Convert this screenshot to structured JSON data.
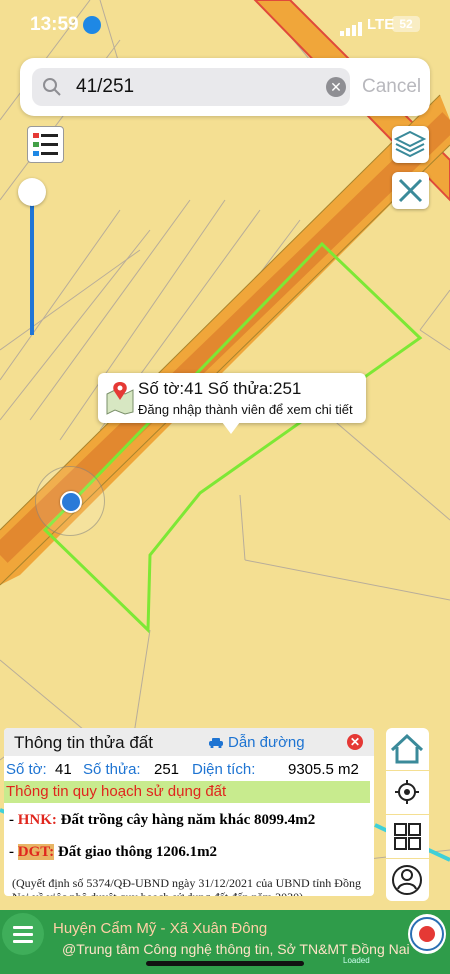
{
  "status_bar": {
    "time": "13:59",
    "network": "LTE",
    "battery": "52"
  },
  "search": {
    "value": "41/251",
    "placeholder": "",
    "cancel_label": "Cancel"
  },
  "popup": {
    "title": "Số tờ:41 Số thửa:251",
    "subtitle": "Đăng nhập thành viên để xem chi tiết"
  },
  "panel": {
    "title": "Thông tin thửa đất",
    "nav_label": "Dẫn đường",
    "sheet_label": "Số tờ:",
    "sheet_value": "41",
    "parcel_label": "Số thửa:",
    "parcel_value": "251",
    "area_label": "Diện tích:",
    "area_value": "9305.5 m2",
    "plan_header": "Thông tin quy hoạch sử dụng đất",
    "land_uses": [
      {
        "prefix": "- ",
        "code": "HNK:",
        "text": " Đất trồng cây hàng năm khác 8099.4m2"
      },
      {
        "prefix": "- ",
        "code": "DGT:",
        "text": " Đất giao thông 1206.1m2"
      }
    ],
    "decision": "(Quyết định số 5374/QĐ-UBND ngày 31/12/2021 của UBND tỉnh Đồng Nai về việc phê duyệt quy hoạch sử dụng đất đến năm 2030)"
  },
  "footer": {
    "district": "Huyện Cẩm Mỹ - Xã Xuân Đông",
    "credit": "@Trung tâm Công nghệ thông tin, Sở TN&MT Đồng Nai",
    "status": "Loaded"
  },
  "colors": {
    "road": "#f0a63a",
    "parcel_outline": "#7de835",
    "accent": "#1e74d2",
    "bar": "#2f9c4a"
  }
}
